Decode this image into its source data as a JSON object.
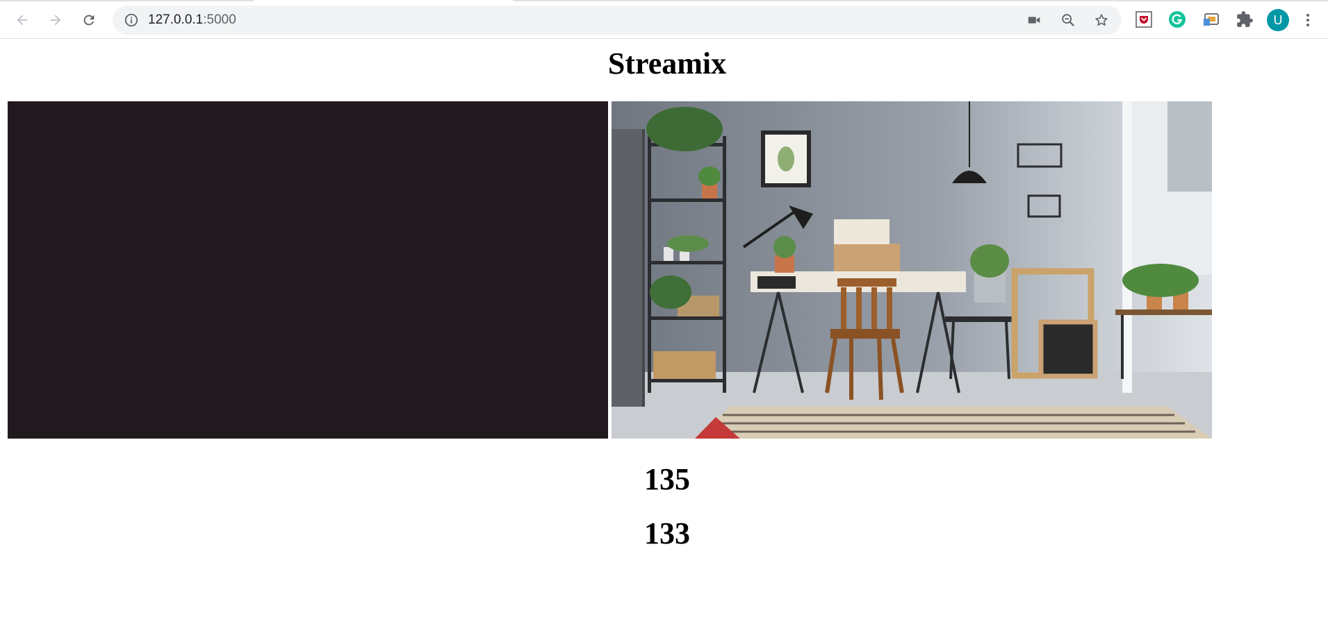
{
  "browser": {
    "url_host": "127.0.0.1",
    "url_port": ":5000",
    "profile_initial": "U",
    "colors": {
      "omnibox": "#f1f3f4",
      "avatar": "#0097a7"
    }
  },
  "page": {
    "title": "Streamix",
    "counts": [
      "135",
      "133"
    ]
  },
  "thumbnails": [
    {
      "kind": "dark-video-frame",
      "color": "#201a1e"
    },
    {
      "kind": "home-office-room-photo"
    }
  ]
}
